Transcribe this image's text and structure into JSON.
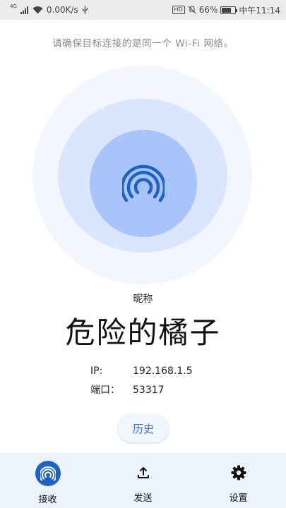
{
  "status_bar": {
    "network": "4G",
    "speed": "0.00K/s",
    "battery": "66%",
    "time": "中午11:14",
    "hd": "HD"
  },
  "hint": "请确保目标连接的是同一个 Wi-Fi 网络。",
  "broadcast": {
    "icon": "broadcast-icon"
  },
  "nickname": {
    "label": "昵称",
    "value": "危险的橘子"
  },
  "info": {
    "ip_label": "IP:",
    "ip_value": "192.168.1.5",
    "port_label": "端口：",
    "port_value": "53317"
  },
  "history_button": "历史",
  "nav": {
    "items": [
      {
        "label": "接收",
        "icon": "broadcast-icon",
        "active": true
      },
      {
        "label": "发送",
        "icon": "upload-icon",
        "active": false
      },
      {
        "label": "设置",
        "icon": "gear-icon",
        "active": false
      }
    ]
  },
  "colors": {
    "accent": "#1e63c2",
    "ring_outer": "#f3f6fe",
    "ring_mid": "#dbe5fd",
    "ring_inner": "#a9c4fb",
    "nav_bg": "#ecf3fd"
  }
}
